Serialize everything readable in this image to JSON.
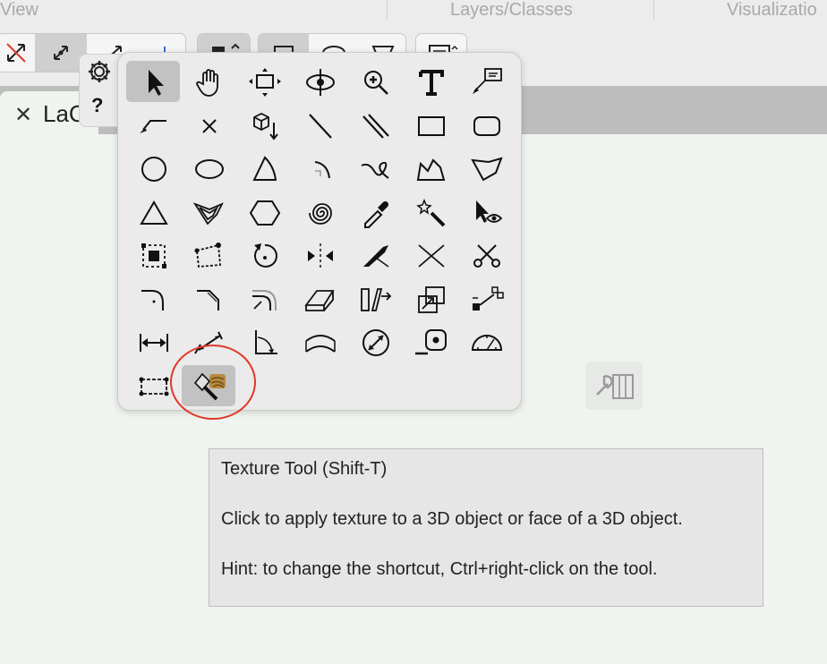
{
  "header": {
    "view_label": "View",
    "layers_label": "Layers/Classes",
    "visualization_label": "Visualizatio"
  },
  "document_tab": {
    "close_glyph": "✕",
    "title": "LaC"
  },
  "side_panel": {
    "help_label": "?",
    "settings_icon": "gear-icon"
  },
  "tool_popup": {
    "selected_tool": "texture-tool",
    "tools": [
      "selection",
      "pan",
      "flyover",
      "walkthrough",
      "zoom",
      "text",
      "callout",
      "polyline-arrow",
      "delete",
      "push-pull",
      "line",
      "double-line",
      "rectangle",
      "rounded-rectangle",
      "circle",
      "oval",
      "arc",
      "quarter-arc",
      "freehand",
      "polygon",
      "double-polygon",
      "triangle",
      "reshape",
      "hexagon",
      "spiral",
      "eyedropper",
      "magic-wand",
      "visibility",
      "offset",
      "reshape-points",
      "rotate",
      "mirror",
      "split",
      "trim",
      "clip",
      "fillet",
      "chamfer",
      "connect",
      "eraser",
      "duplicate-array",
      "move-by-points",
      "attribute-mapping",
      "dimension",
      "angle-dimension",
      "angle",
      "arc-dimension",
      "diameter",
      "tape-measure",
      "protractor",
      "create-wall",
      "texture-tool"
    ]
  },
  "tooltip": {
    "title": "Texture Tool (Shift-T)",
    "description": "Click to apply texture to a 3D object or face of a 3D object.",
    "hint": "Hint: to change the shortcut, Ctrl+right-click on the tool."
  },
  "colors": {
    "highlight_ring": "#e0392b",
    "canvas": "#eff4ee",
    "selected_tool_bg": "#c2c2c2"
  }
}
